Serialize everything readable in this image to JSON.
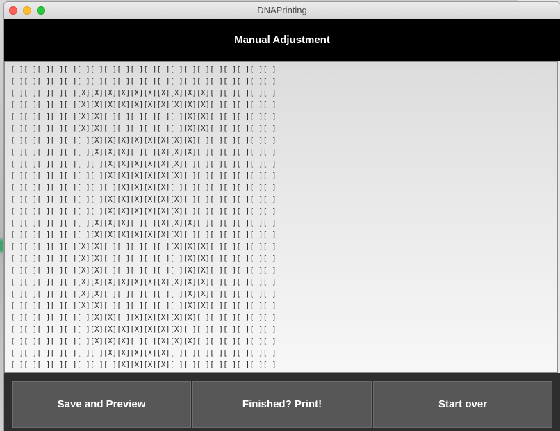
{
  "window": {
    "title": "DNAPrinting"
  },
  "header": {
    "title": "Manual Adjustment"
  },
  "grid": {
    "rows": [
      "[ ][ ][ ][ ][ ][ ][ ][ ][ ][ ][ ][ ][ ][ ][ ][ ][ ][ ][ ][ ]",
      "[ ][ ][ ][ ][ ][ ][ ][ ][ ][ ][ ][ ][ ][ ][ ][ ][ ][ ][ ][ ]",
      "[ ][ ][ ][ ][ ][X][X][X][X][X][X][X][X][X][X][ ][ ][ ][ ][ ]",
      "[ ][ ][ ][ ][ ][X][X][X][X][X][X][X][X][X][X][ ][ ][ ][ ][ ]",
      "[ ][ ][ ][ ][ ][X][X][ ][ ][ ][ ][ ][ ][X][X][ ][ ][ ][ ][ ]",
      "[ ][ ][ ][ ][ ][X][X][ ][ ][ ][ ][ ][ ][X][X][ ][ ][ ][ ][ ]",
      "[ ][ ][ ][ ][ ][ ][X][X][X][X][X][X][X][X][ ][ ][ ][ ][ ][ ]",
      "[ ][ ][ ][ ][ ][ ][X][X][X][ ][ ][X][X][X][ ][ ][ ][ ][ ][ ]",
      "[ ][ ][ ][ ][ ][ ][ ][X][X][X][X][X][X][ ][ ][ ][ ][ ][ ][ ]",
      "[ ][ ][ ][ ][ ][ ][ ][X][X][X][X][X][X][ ][ ][ ][ ][ ][ ][ ]",
      "[ ][ ][ ][ ][ ][ ][ ][ ][X][X][X][X][ ][ ][ ][ ][ ][ ][ ][ ]",
      "[ ][ ][ ][ ][ ][ ][ ][X][X][X][X][X][X][ ][ ][ ][ ][ ][ ][ ]",
      "[ ][ ][ ][ ][ ][ ][ ][X][X][X][X][X][X][ ][ ][ ][ ][ ][ ][ ]",
      "[ ][ ][ ][ ][ ][ ][X][X][X][ ][ ][X][X][X][ ][ ][ ][ ][ ][ ]",
      "[ ][ ][ ][ ][ ][ ][X][X][X][X][X][X][X][ ][ ][ ][ ][ ][ ][ ]",
      "[ ][ ][ ][ ][ ][X][X][ ][ ][ ][ ][ ][X][X][X][ ][ ][ ][ ][ ]",
      "[ ][ ][ ][ ][ ][X][X][ ][ ][ ][ ][ ][ ][X][X][ ][ ][ ][ ][ ]",
      "[ ][ ][ ][ ][ ][X][X][ ][ ][ ][ ][ ][ ][X][X][ ][ ][ ][ ][ ]",
      "[ ][ ][ ][ ][ ][X][X][X][X][X][X][X][X][X][X][ ][ ][ ][ ][ ]",
      "[ ][ ][ ][ ][ ][X][X][ ][ ][ ][ ][ ][ ][X][X][ ][ ][ ][ ][ ]",
      "[ ][ ][ ][ ][ ][X][X][ ][ ][ ][ ][ ][ ][X][X][ ][ ][ ][ ][ ]",
      "[ ][ ][ ][ ][ ][ ][X][X][ ][X][X][X][X][X][ ][ ][ ][ ][ ][ ]",
      "[ ][ ][ ][ ][ ][ ][X][X][X][X][X][X][X][ ][ ][ ][ ][ ][ ][ ]",
      "[ ][ ][ ][ ][ ][ ][X][X][X][ ][ ][X][X][X][ ][ ][ ][ ][ ][ ]",
      "[ ][ ][ ][ ][ ][ ][ ][X][X][X][X][X][ ][ ][ ][ ][ ][ ][ ][ ]",
      "[ ][ ][ ][ ][ ][ ][ ][ ][X][X][X][X][ ][ ][ ][ ][ ][ ][ ][ ]"
    ]
  },
  "buttons": {
    "save": "Save and Preview",
    "print": "Finished? Print!",
    "reset": "Start over"
  },
  "colors": {
    "header_bg": "#000000",
    "button_bg": "#575757",
    "bottom_bar_bg": "#2e2e2e"
  }
}
